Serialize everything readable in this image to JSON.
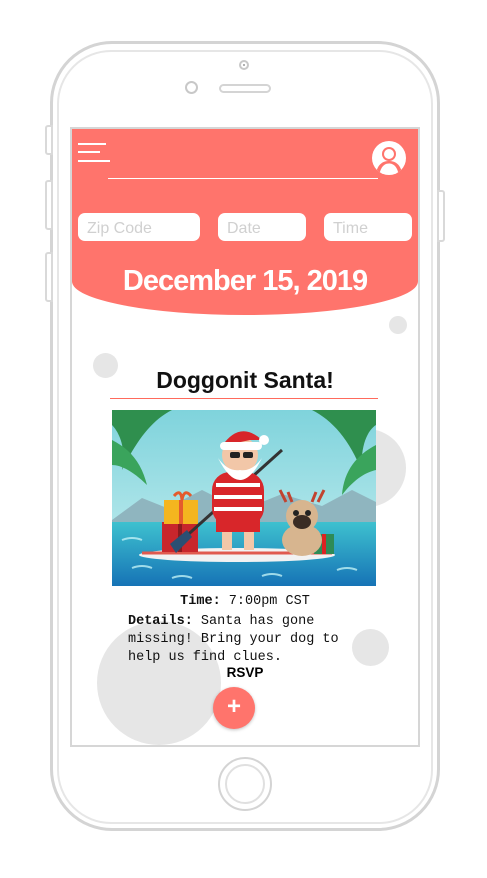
{
  "header": {
    "menu_icon": "hamburger-menu-icon",
    "profile_icon": "user-profile-icon",
    "accent_color": "#ff746c"
  },
  "search": {
    "zip_placeholder": "Zip Code",
    "date_placeholder": "Date",
    "time_placeholder": "Time"
  },
  "date_heading": "December 15, 2019",
  "event": {
    "title": "Doggonit Santa!",
    "image_icon": "santa-paddleboard-pug-illustration",
    "time_label": "Time:",
    "time_value": "7:00pm CST",
    "details_label": "Details:",
    "details_value": "Santa has gone missing! Bring your dog to help us find clues.",
    "rsvp_label": "RSVP",
    "add_button_label": "+"
  }
}
